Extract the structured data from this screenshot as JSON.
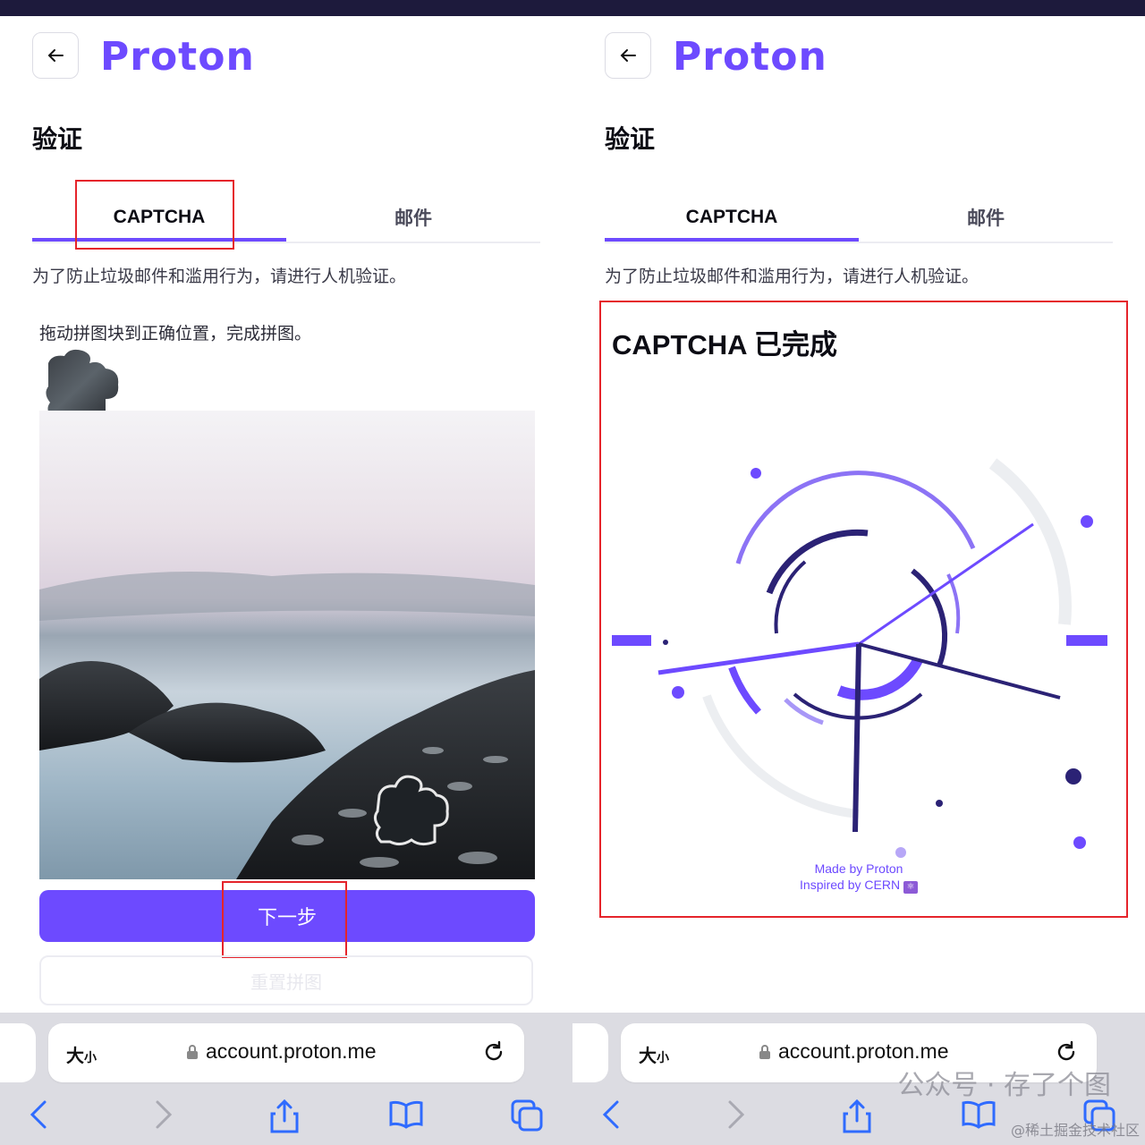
{
  "brand": {
    "logo_text": "Proton",
    "color": "#6d4aff"
  },
  "left": {
    "title": "验证",
    "tabs": [
      {
        "label": "CAPTCHA"
      },
      {
        "label": "邮件"
      }
    ],
    "description": "为了防止垃圾邮件和滥用行为，请进行人机验证。",
    "hint": "拖动拼图块到正确位置，完成拼图。",
    "next_label": "下一步",
    "reset_label": "重置拼图"
  },
  "right": {
    "title": "验证",
    "tabs": [
      {
        "label": "CAPTCHA"
      },
      {
        "label": "邮件"
      }
    ],
    "description": "为了防止垃圾邮件和滥用行为，请进行人机验证。",
    "captcha_done": "CAPTCHA 已完成",
    "made_by": "Made by Proton",
    "inspired_by": "Inspired by CERN"
  },
  "browser": {
    "text_size_label": "大",
    "text_size_small": "小",
    "url": "account.proton.me",
    "icons": [
      "back-icon",
      "forward-icon",
      "share-icon",
      "bookmarks-icon",
      "tabs-icon",
      "reload-icon",
      "lock-icon"
    ]
  },
  "watermark": {
    "text": "公众号 · 存了个图",
    "sub": "@稀土掘金技术社区"
  },
  "colors": {
    "accent": "#6d4aff",
    "highlight": "#e5242b",
    "dark": "#1d1a3c"
  }
}
